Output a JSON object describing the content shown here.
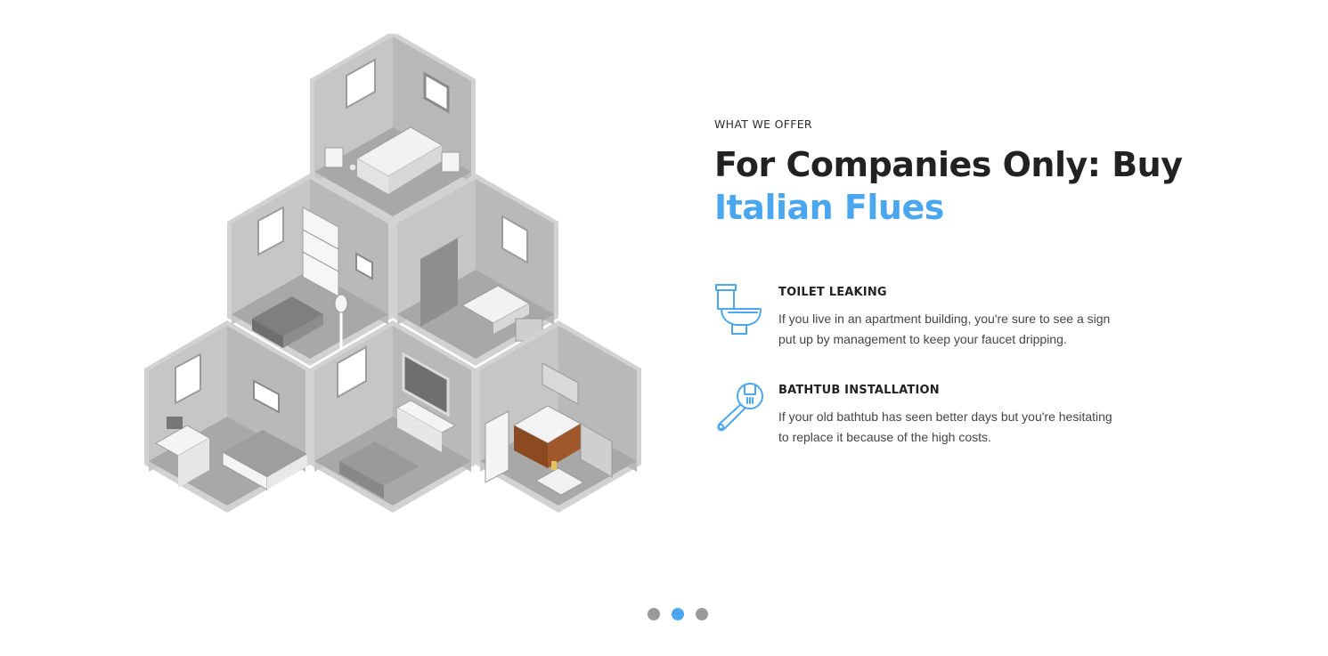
{
  "section": {
    "eyebrow": "WHAT WE OFFER",
    "heading_line1": "For Companies Only: Buy",
    "heading_line2": "Italian Flues"
  },
  "features": [
    {
      "icon": "toilet-icon",
      "title": "TOILET LEAKING",
      "description": "If you live in an apartment building, you're sure to see a sign put up by management to keep your faucet dripping."
    },
    {
      "icon": "wrench-icon",
      "title": "BATHTUB INSTALLATION",
      "description": "If your old bathtub has seen better days but you're hesitating to replace it because of the high costs."
    }
  ],
  "illustration": {
    "name": "isometric-house-rooms"
  },
  "slider": {
    "dots": 3,
    "active_index": 1
  },
  "colors": {
    "accent": "#4aa6ee",
    "text_dark": "#222222",
    "text_body": "#444444",
    "dot_inactive": "#9a9a9a"
  }
}
